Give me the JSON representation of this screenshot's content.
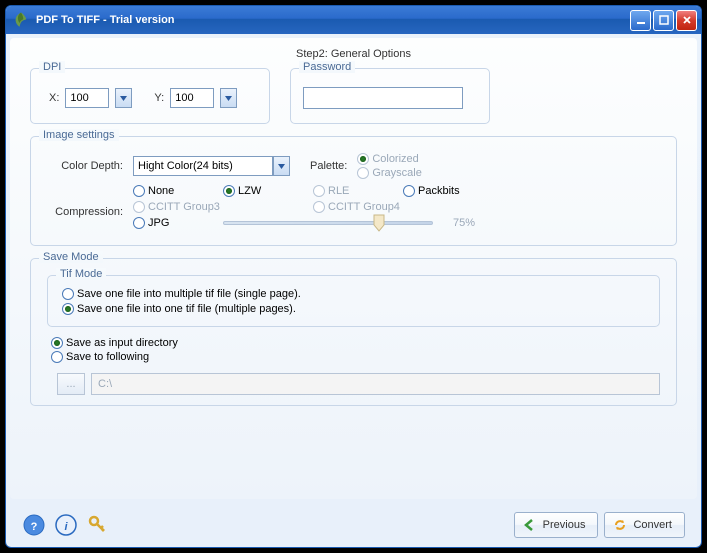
{
  "window": {
    "title": "PDF To TIFF - Trial version"
  },
  "step_title": "Step2: General Options",
  "dpi": {
    "legend": "DPI",
    "x_label": "X:",
    "x_value": "100",
    "y_label": "Y:",
    "y_value": "100"
  },
  "password": {
    "legend": "Password",
    "value": ""
  },
  "image_settings": {
    "legend": "Image settings",
    "color_depth_label": "Color Depth:",
    "color_depth_value": "Hight Color(24 bits)",
    "palette_label": "Palette:",
    "palette_options": {
      "colorized": "Colorized",
      "grayscale": "Grayscale"
    },
    "compression_label": "Compression:",
    "compression": {
      "none": "None",
      "lzw": "LZW",
      "rle": "RLE",
      "packbits": "Packbits",
      "ccitt3": "CCITT Group3",
      "ccitt4": "CCITT Group4",
      "jpg": "JPG"
    },
    "jpg_quality": "75%"
  },
  "save_mode": {
    "legend": "Save Mode",
    "tif_legend": "Tif Mode",
    "single": "Save one file into multiple tif file (single page).",
    "multi": "Save one file into one tif file (multiple pages).",
    "as_input": "Save as input directory",
    "to_following": "Save to following",
    "browse": "...",
    "path": "C:\\"
  },
  "footer": {
    "previous": "Previous",
    "convert": "Convert"
  }
}
